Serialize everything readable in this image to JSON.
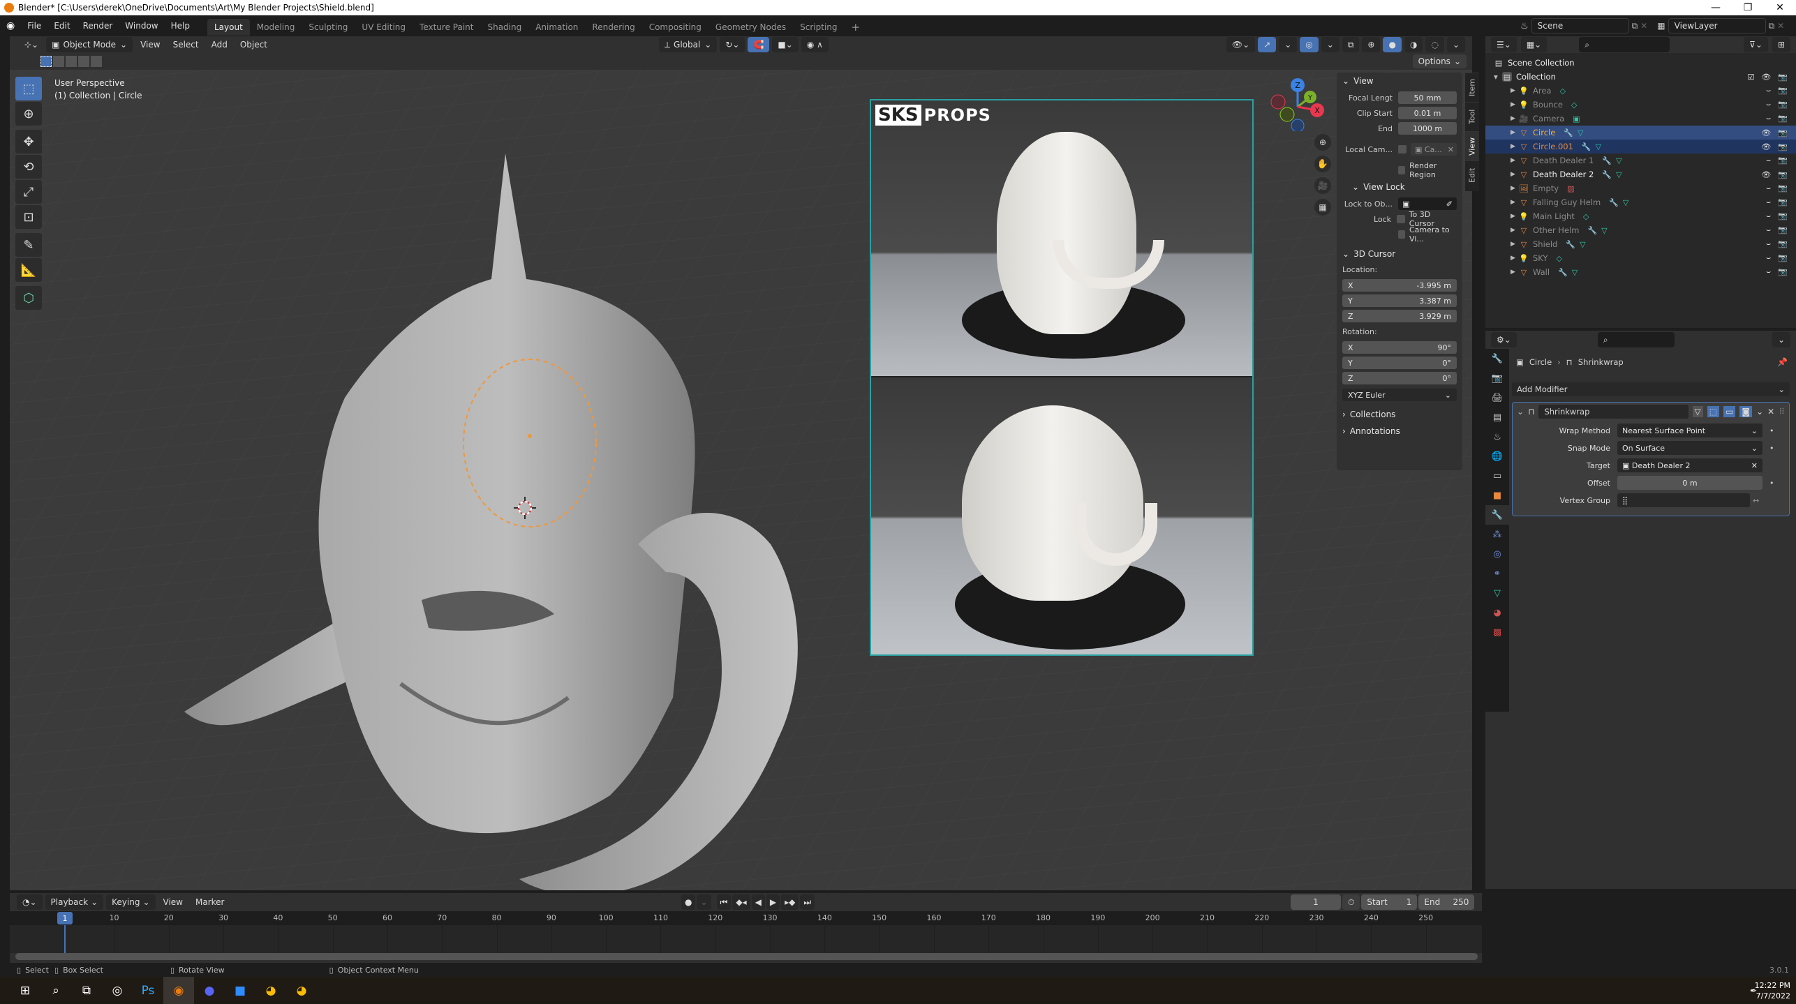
{
  "window": {
    "title": "Blender* [C:\\Users\\derek\\OneDrive\\Documents\\Art\\My Blender Projects\\Shield.blend]",
    "controls": [
      "—",
      "❐",
      "✕"
    ]
  },
  "menubar": {
    "menus": [
      "File",
      "Edit",
      "Render",
      "Window",
      "Help"
    ],
    "workspaces": [
      "Layout",
      "Modeling",
      "Sculpting",
      "UV Editing",
      "Texture Paint",
      "Shading",
      "Animation",
      "Rendering",
      "Compositing",
      "Geometry Nodes",
      "Scripting"
    ],
    "active_workspace": "Layout",
    "add_workspace": "+",
    "scene": "Scene",
    "view_layer": "ViewLayer"
  },
  "viewport_header": {
    "mode": "Object Mode",
    "menus": [
      "View",
      "Select",
      "Add",
      "Object"
    ],
    "transform_orientation": "Global",
    "options_label": "Options"
  },
  "viewport": {
    "perspective": "User Perspective",
    "collection_info": "(1) Collection | Circle",
    "gizmo_axes": [
      "Z",
      "Y",
      "X"
    ],
    "reference_image_brand": {
      "sks": "SKS",
      "props": "PROPS"
    }
  },
  "npanel": {
    "tabs": [
      "Item",
      "Tool",
      "View",
      "Edit"
    ],
    "active_tab": "View",
    "view": {
      "title": "View",
      "focal_length_label": "Focal Lengt",
      "focal_length": "50 mm",
      "clip_start_label": "Clip Start",
      "clip_start": "0.01 m",
      "end_label": "End",
      "end": "1000 m",
      "local_camera_label": "Local Cam...",
      "local_camera_value": "Ca...",
      "render_region_label": "Render Region"
    },
    "view_lock": {
      "title": "View Lock",
      "lock_to_object_label": "Lock to Ob...",
      "lock_label": "Lock",
      "to_3d_cursor": "To 3D Cursor",
      "camera_to_view": "Camera to Vi..."
    },
    "cursor": {
      "title": "3D Cursor",
      "location_label": "Location:",
      "location": [
        {
          "axis": "X",
          "value": "-3.995 m"
        },
        {
          "axis": "Y",
          "value": "3.387 m"
        },
        {
          "axis": "Z",
          "value": "3.929 m"
        }
      ],
      "rotation_label": "Rotation:",
      "rotation": [
        {
          "axis": "X",
          "value": "90°"
        },
        {
          "axis": "Y",
          "value": "0°"
        },
        {
          "axis": "Z",
          "value": "0°"
        }
      ],
      "rotation_mode": "XYZ Euler"
    },
    "collections_title": "Collections",
    "annotations_title": "Annotations"
  },
  "outliner": {
    "root": "Scene Collection",
    "collection": "Collection",
    "items": [
      {
        "name": "Area",
        "type": "light",
        "state": "hidden"
      },
      {
        "name": "Bounce",
        "type": "light",
        "state": "hidden"
      },
      {
        "name": "Camera",
        "type": "camera",
        "state": "hidden"
      },
      {
        "name": "Circle",
        "type": "mesh",
        "state": "active"
      },
      {
        "name": "Circle.001",
        "type": "mesh",
        "state": "selected"
      },
      {
        "name": "Death Dealer 1",
        "type": "mesh",
        "state": "hidden"
      },
      {
        "name": "Death Dealer 2",
        "type": "mesh",
        "state": "visible"
      },
      {
        "name": "Empty",
        "type": "image",
        "state": "hidden"
      },
      {
        "name": "Falling Guy Helm",
        "type": "mesh",
        "state": "hidden"
      },
      {
        "name": "Main Light",
        "type": "light",
        "state": "hidden"
      },
      {
        "name": "Other Helm",
        "type": "mesh",
        "state": "hidden"
      },
      {
        "name": "Shield",
        "type": "mesh",
        "state": "hidden"
      },
      {
        "name": "SKY",
        "type": "light",
        "state": "hidden"
      },
      {
        "name": "Wall",
        "type": "mesh",
        "state": "hidden"
      }
    ]
  },
  "properties": {
    "breadcrumb_object": "Circle",
    "breadcrumb_modifier": "Shrinkwrap",
    "add_modifier": "Add Modifier",
    "modifier": {
      "name": "Shrinkwrap",
      "wrap_method_label": "Wrap Method",
      "wrap_method": "Nearest Surface Point",
      "snap_mode_label": "Snap Mode",
      "snap_mode": "On Surface",
      "target_label": "Target",
      "target": "Death Dealer 2",
      "offset_label": "Offset",
      "offset": "0 m",
      "vertex_group_label": "Vertex Group"
    }
  },
  "timeline": {
    "menus": [
      "Playback",
      "Keying",
      "View",
      "Marker"
    ],
    "current_frame": "1",
    "start_label": "Start",
    "start": "1",
    "end_label": "End",
    "end": "250",
    "ticks": [
      "10",
      "20",
      "30",
      "40",
      "50",
      "60",
      "70",
      "80",
      "90",
      "100",
      "110",
      "120",
      "130",
      "140",
      "150",
      "160",
      "170",
      "180",
      "190",
      "200",
      "210",
      "220",
      "230",
      "240",
      "250"
    ]
  },
  "statusbar": {
    "select": "Select",
    "box_select": "Box Select",
    "rotate_view": "Rotate View",
    "context_menu": "Object Context Menu",
    "version": "3.0.1"
  },
  "taskbar": {
    "time": "12:22 PM",
    "date": "7/7/2022"
  },
  "colors": {
    "accent": "#4772b3",
    "active_object": "#ffaf29",
    "selected_object": "#e8883d",
    "mesh_icon": "#e8883d",
    "modifier_icon": "#6f8dd6",
    "data_icon": "#2fc4a3"
  }
}
